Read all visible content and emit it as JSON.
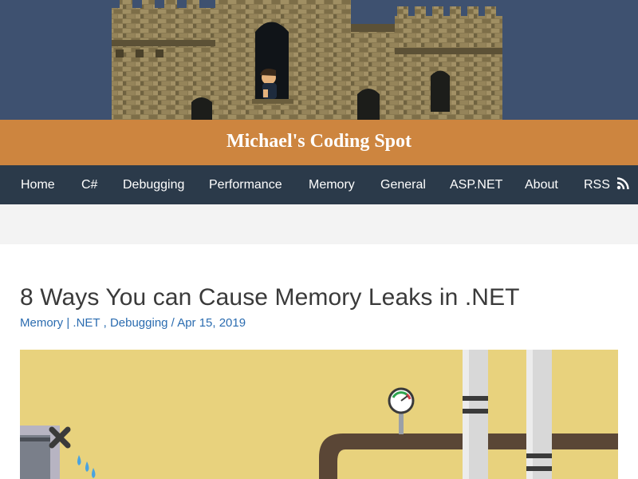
{
  "header": {
    "site_title": "Michael's Coding Spot",
    "colors": {
      "sky": "#3e5170",
      "title_bar": "#cd853f",
      "nav_bg": "#2b3a4a",
      "link": "#2b6cb0"
    }
  },
  "nav": {
    "items": [
      {
        "label": "Home"
      },
      {
        "label": "C#"
      },
      {
        "label": "Debugging"
      },
      {
        "label": "Performance"
      },
      {
        "label": "Memory"
      },
      {
        "label": "General"
      },
      {
        "label": "ASP.NET"
      },
      {
        "label": "About"
      },
      {
        "label": "RSS",
        "icon": "rss-icon"
      }
    ]
  },
  "post": {
    "title": "8 Ways You can Cause Memory Leaks in .NET",
    "category_primary": "Memory",
    "separator_pipe": "|",
    "category_net": ".NET",
    "category_comma": ",",
    "category_debugging": "Debugging",
    "date_separator": "/",
    "date": "Apr 15, 2019",
    "featured_image": {
      "subject": "pipes-leaking-illustration",
      "background": "#e8d27d"
    }
  }
}
